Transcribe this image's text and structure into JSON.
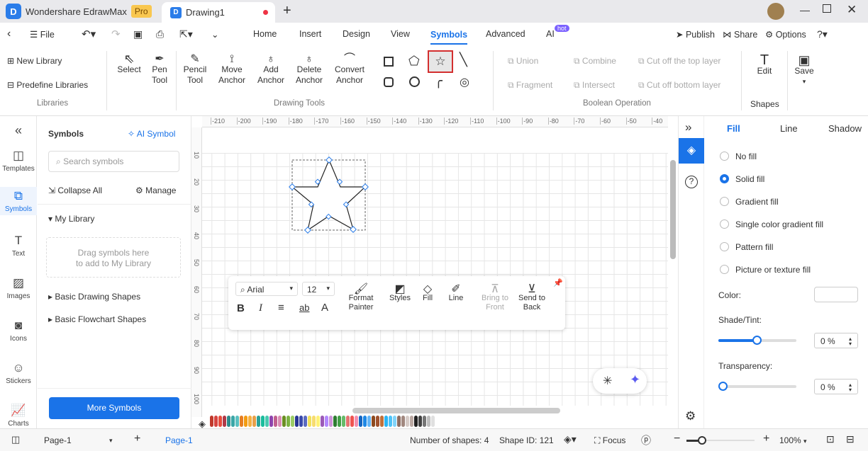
{
  "app": {
    "name": "Wondershare EdrawMax",
    "badge": "Pro",
    "doc_tab": "Drawing1"
  },
  "menu": {
    "file": "File",
    "tabs": [
      "Home",
      "Insert",
      "Design",
      "View",
      "Symbols",
      "Advanced",
      "AI"
    ],
    "active": "Symbols",
    "ai_badge": "hot",
    "publish": "Publish",
    "share": "Share",
    "options": "Options"
  },
  "ribbon": {
    "libraries": {
      "new": "New Library",
      "predefine": "Predefine Libraries",
      "group": "Libraries"
    },
    "drawing": {
      "select": "Select",
      "pen1": "Pen",
      "pen2": "Tool",
      "pencil1": "Pencil",
      "pencil2": "Tool",
      "move1": "Move",
      "move2": "Anchor",
      "add1": "Add",
      "add2": "Anchor",
      "del1": "Delete",
      "del2": "Anchor",
      "conv1": "Convert",
      "conv2": "Anchor",
      "group": "Drawing Tools",
      "selected_shape": "star"
    },
    "boolean": {
      "union": "Union",
      "combine": "Combine",
      "cut_top": "Cut off the top layer",
      "fragment": "Fragment",
      "intersect": "Intersect",
      "cut_bottom": "Cut off bottom layer",
      "group": "Boolean Operation"
    },
    "edit": "Edit",
    "shapes": "Shapes",
    "save": "Save"
  },
  "leftbar": [
    "Templates",
    "Symbols",
    "Text",
    "Images",
    "Icons",
    "Stickers",
    "Charts"
  ],
  "panel": {
    "title": "Symbols",
    "ai": "AI Symbol",
    "search_placeholder": "Search symbols",
    "collapse": "Collapse All",
    "manage": "Manage",
    "my_library": "My Library",
    "drop1": "Drag symbols here",
    "drop2": "to add to My Library",
    "basic_drawing": "Basic Drawing Shapes",
    "basic_flowchart": "Basic Flowchart Shapes",
    "more": "More Symbols"
  },
  "ruler": {
    "top": [
      "-210",
      "-200",
      "-190",
      "-180",
      "-170",
      "-160",
      "-150",
      "-140",
      "-130",
      "-120",
      "-110",
      "-100",
      "-90",
      "-80",
      "-70",
      "-60",
      "-50",
      "-40"
    ],
    "left": [
      "10",
      "20",
      "30",
      "40",
      "50",
      "60",
      "70",
      "80",
      "90",
      "100"
    ]
  },
  "float": {
    "font": "Arial",
    "size": "12",
    "format1": "Format",
    "format2": "Painter",
    "styles": "Styles",
    "fill": "Fill",
    "line": "Line",
    "front1": "Bring to",
    "front2": "Front",
    "back1": "Send to",
    "back2": "Back"
  },
  "right": {
    "tabs": [
      "Fill",
      "Line",
      "Shadow"
    ],
    "fill_options": [
      "No fill",
      "Solid fill",
      "Gradient fill",
      "Single color gradient fill",
      "Pattern fill",
      "Picture or texture fill"
    ],
    "selected": "Solid fill",
    "color": "Color:",
    "shade": "Shade/Tint:",
    "shade_val": "0 %",
    "transparency": "Transparency:",
    "trans_val": "0 %",
    "shade_level": 0,
    "transparency_level": 0
  },
  "status": {
    "page_select": "Page-1",
    "page_tab": "Page-1",
    "shapes": "Number of shapes: 4",
    "shape_id": "Shape ID: 121",
    "focus": "Focus",
    "zoom": "100%"
  },
  "colors": {
    "accent": "#1a73e8",
    "palette": [
      "#c0392b",
      "#d64541",
      "#e74c3c",
      "#b03a48",
      "#2e8b8b",
      "#3aa6a6",
      "#5bc0c0",
      "#e67e22",
      "#f39c12",
      "#f5b041",
      "#e8a04a",
      "#2aa198",
      "#1abc9c",
      "#48c9b0",
      "#8e44ad",
      "#c0608f",
      "#d98cb3",
      "#6b8e23",
      "#7cb342",
      "#9ccc65",
      "#283593",
      "#3949ab",
      "#5c6bc0",
      "#f1e05a",
      "#f7dc6f",
      "#fff176",
      "#9b59b6",
      "#b388ff",
      "#ce93d8",
      "#2e7d32",
      "#43a047",
      "#66bb6a",
      "#e57373",
      "#ef5350",
      "#f48fb1",
      "#1565c0",
      "#1e88e5",
      "#64b5f6",
      "#8d4a1f",
      "#a0522d",
      "#c0703a",
      "#29b6f6",
      "#4fc3f7",
      "#81d4fa",
      "#8d6e63",
      "#a1887f",
      "#d7ccc8",
      "#bcaaa4",
      "#212121",
      "#424242",
      "#757575",
      "#bdbdbd",
      "#e0e0e0"
    ]
  }
}
